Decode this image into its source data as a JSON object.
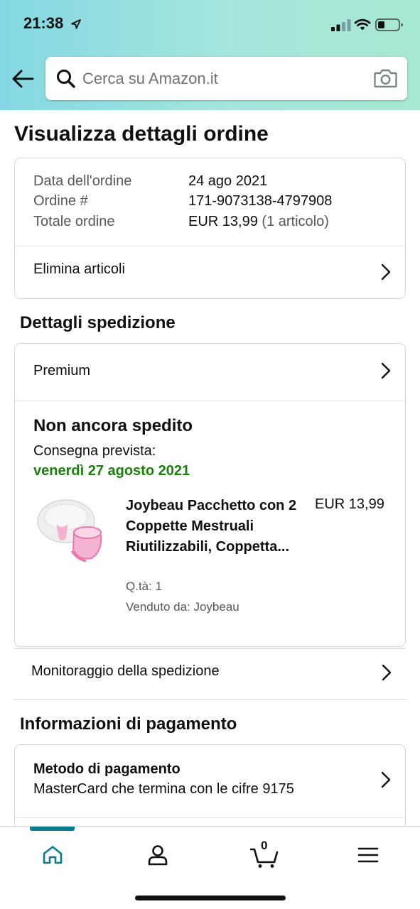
{
  "status_bar": {
    "time": "21:38"
  },
  "search": {
    "placeholder": "Cerca su Amazon.it"
  },
  "page": {
    "title": "Visualizza dettagli ordine"
  },
  "order_summary": {
    "rows": [
      {
        "label": "Data dell'ordine",
        "value": "24 ago 2021"
      },
      {
        "label": "Ordine #",
        "value": "171-9073138-4797908"
      },
      {
        "label": "Totale ordine",
        "value": "EUR 13,99",
        "extra": "(1 articolo)"
      }
    ],
    "delete_items_label": "Elimina articoli"
  },
  "shipping": {
    "section_title": "Dettagli spedizione",
    "service": "Premium",
    "status": "Non ancora spedito",
    "delivery_label": "Consegna prevista:",
    "delivery_date": "venerdì 27 agosto 2021",
    "product": {
      "title": "Joybeau Pacchetto con 2 Coppette Mestruali Riutilizzabili, Coppetta...",
      "price": "EUR 13,99",
      "quantity": "Q.tà: 1",
      "seller": "Venduto da: Joybeau"
    },
    "tracking_label": "Monitoraggio della spedizione"
  },
  "payment": {
    "section_title": "Informazioni di pagamento",
    "method_label": "Metodo di pagamento",
    "method_value": "MasterCard che termina con le cifre 9175"
  },
  "bottom_nav": {
    "cart_count": "0",
    "active_tab": "home"
  },
  "colors": {
    "header_gradient_start": "#84d8e3",
    "header_gradient_end": "#a6e8d2",
    "accent": "#0a7d8c",
    "delivery_green": "#1a7f0b"
  },
  "icons": [
    "location-arrow-icon",
    "signal-icon",
    "wifi-icon",
    "battery-icon",
    "back-arrow-icon",
    "search-icon",
    "camera-icon",
    "chevron-right-icon",
    "home-icon",
    "account-icon",
    "cart-icon",
    "menu-icon"
  ]
}
